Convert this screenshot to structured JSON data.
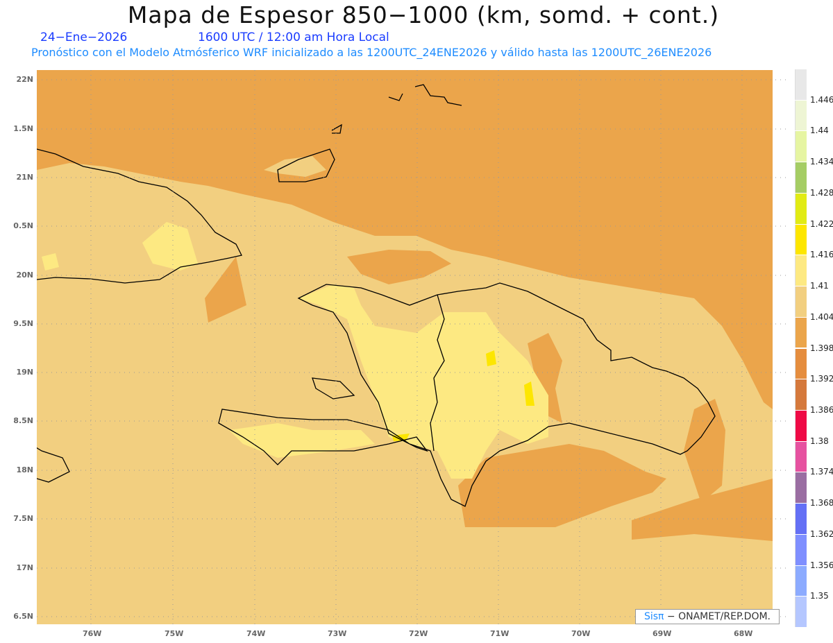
{
  "title": "Mapa de Espesor 850−1000 (km, somd. + cont.)",
  "date": "24−Ene−2026",
  "time": "1600 UTC / 12:00 am Hora Local",
  "subtitle": "Pronóstico con el Modelo Atmósferico WRF inicializado a las 1200UTC_24ENE2026 y válido hasta las  1200UTC_26ENE2026",
  "lat_labels": [
    "22N",
    "1.5N",
    "21N",
    "0.5N",
    "20N",
    "9.5N",
    "19N",
    "8.5N",
    "18N",
    "7.5N",
    "17N",
    "6.5N"
  ],
  "lon_labels": [
    "76W",
    "75W",
    "74W",
    "73W",
    "72W",
    "71W",
    "70W",
    "69W",
    "68W"
  ],
  "colorbar": {
    "labels": [
      "1.446",
      "1.44",
      "1.434",
      "1.428",
      "1.422",
      "1.416",
      "1.41",
      "1.404",
      "1.398",
      "1.392",
      "1.386",
      "1.38",
      "1.374",
      "1.368",
      "1.362",
      "1.356",
      "1.35"
    ],
    "colors": [
      "#e8e8e8",
      "#eef5d4",
      "#e6f5a2",
      "#a5cd64",
      "#e1eb14",
      "#fde600",
      "#fde982",
      "#f2cf80",
      "#eba54b",
      "#e58d3e",
      "#d5793c",
      "#ef0a46",
      "#e652a0",
      "#9a6ea2",
      "#6470f5",
      "#7f8fff",
      "#8cabff",
      "#b5c7ff"
    ]
  },
  "credit": {
    "brand": "Sisπ",
    "text": " −  ONAMET/REP.DOM."
  }
}
